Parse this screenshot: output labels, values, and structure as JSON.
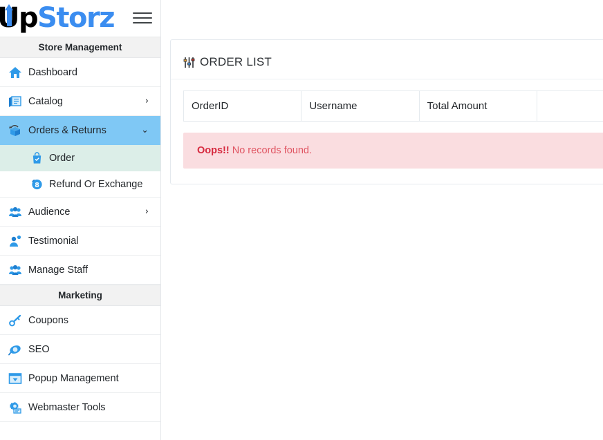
{
  "brand": {
    "logo_up": "Up",
    "logo_storz": "Storz",
    "menu_toggle_name": "hamburger-menu"
  },
  "sidebar": {
    "sections": [
      {
        "heading": "Store Management",
        "items": [
          {
            "label": "Dashboard",
            "icon": "home-icon",
            "chevron": "",
            "active": false,
            "children": []
          },
          {
            "label": "Catalog",
            "icon": "catalog-icon",
            "chevron": "›",
            "active": false,
            "children": []
          },
          {
            "label": "Orders & Returns",
            "icon": "orders-box-icon",
            "chevron": "⌄",
            "active": true,
            "children": [
              {
                "label": "Order",
                "icon": "shopping-bag-icon",
                "active": true
              },
              {
                "label": "Refund Or Exchange",
                "icon": "refund-icon",
                "active": false
              }
            ]
          },
          {
            "label": "Audience",
            "icon": "users-icon",
            "chevron": "›",
            "active": false,
            "children": []
          },
          {
            "label": "Testimonial",
            "icon": "user-quote-icon",
            "chevron": "",
            "active": false,
            "children": []
          },
          {
            "label": "Manage Staff",
            "icon": "staff-icon",
            "chevron": "",
            "active": false,
            "children": []
          }
        ]
      },
      {
        "heading": "Marketing",
        "items": [
          {
            "label": "Coupons",
            "icon": "coupon-key-icon",
            "chevron": "",
            "active": false,
            "children": []
          },
          {
            "label": "SEO",
            "icon": "seo-icon",
            "chevron": "",
            "active": false,
            "children": []
          },
          {
            "label": "Popup Management",
            "icon": "popup-icon",
            "chevron": "",
            "active": false,
            "children": []
          },
          {
            "label": "Webmaster Tools",
            "icon": "webmaster-icon",
            "chevron": "",
            "active": false,
            "children": []
          }
        ]
      }
    ]
  },
  "content": {
    "title": "ORDER LIST",
    "title_icon": "sliders-icon",
    "table": {
      "columns": [
        "OrderID",
        "Username",
        "Total Amount",
        ""
      ],
      "rows": []
    },
    "alert": {
      "strong": "Oops!!",
      "text": " No records found."
    }
  },
  "colors": {
    "accent_blue": "#3b8df0",
    "active_nav": "#7fc8f5",
    "active_sub": "#dceee8",
    "alert_bg": "#fadde0",
    "alert_strong": "#d6293e",
    "alert_text": "#e05562"
  }
}
